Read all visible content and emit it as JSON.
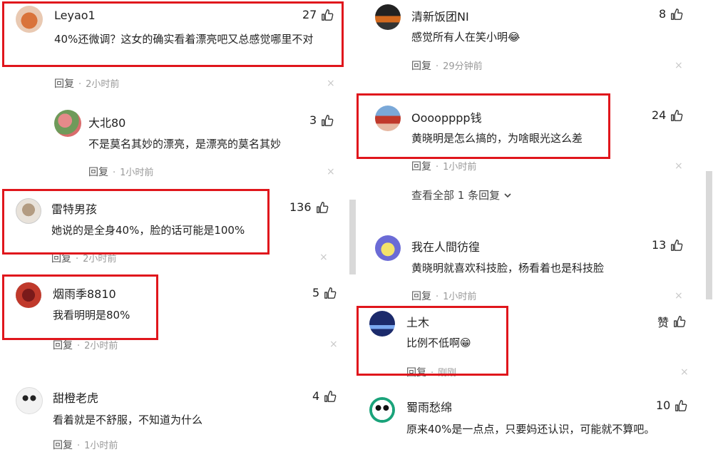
{
  "left": [
    {
      "user": "Leyao1",
      "likes": "27",
      "text": "40%还微调？这女的确实看着漂亮吧又总感觉哪里不对",
      "reply": "回复",
      "time": "2小时前"
    },
    {
      "user": "大北80",
      "likes": "3",
      "text": "不是莫名其妙的漂亮，是漂亮的莫名其妙",
      "reply": "回复",
      "time": "1小时前"
    },
    {
      "user": "雷特男孩",
      "likes": "136",
      "text": "她说的是全身40%，脸的话可能是100%",
      "reply": "回复",
      "time": "2小时前"
    },
    {
      "user": "烟雨季8810",
      "likes": "5",
      "text": "我看明明是80%",
      "reply": "回复",
      "time": "2小时前"
    },
    {
      "user": "甜橙老虎",
      "likes": "4",
      "text": "看着就是不舒服，不知道为什么",
      "reply": "回复",
      "time": "1小时前"
    }
  ],
  "right": [
    {
      "user": "清新饭团NI",
      "likes": "8",
      "text": "感觉所有人在笑小明",
      "emoji": "😂",
      "reply": "回复",
      "time": "29分钟前"
    },
    {
      "user": "Oooopppp钱",
      "likes": "24",
      "text": "黄晓明是怎么搞的，为啥眼光这么差",
      "reply": "回复",
      "time": "1小时前"
    },
    {
      "user": "我在人間彷徨",
      "likes": "13",
      "text": "黄晓明就喜欢科技脸，杨看着也是科技脸",
      "reply": "回复",
      "time": "1小时前"
    },
    {
      "user": "土木",
      "likes": "赞",
      "text": "比例不低啊",
      "emoji": "😁",
      "reply": "回复",
      "time": "刚刚"
    },
    {
      "user": "蜀雨愁绵",
      "likes": "10",
      "text": "原来40%是一点点，只要妈还认识，可能就不算吧。"
    }
  ],
  "view_all": "查看全部 1 条回复",
  "meta_dot": "·",
  "close_glyph": "×",
  "colors": {
    "highlight": "#e0161c",
    "muted": "#999999"
  }
}
